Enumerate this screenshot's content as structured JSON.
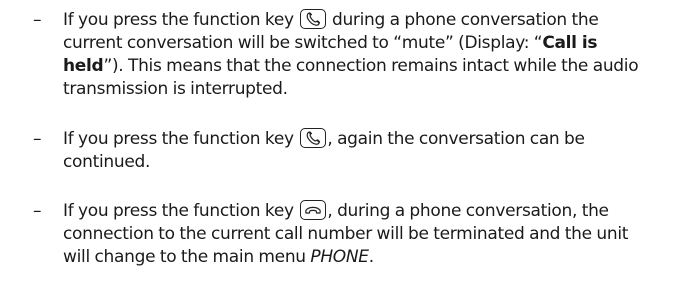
{
  "bullets": [
    {
      "dash": "–",
      "lines": {
        "l1_a": "If you press the function key",
        "l1_b": "during a phone conversation the",
        "l2_a": "current conversation will be switched to “mute” (Display: “",
        "l2_bold": "Call is",
        "l3_bold": "held",
        "l3_b": "”). This means that the connection remains intact while the audio",
        "l4": "transmission is interrupted."
      },
      "key_icon": "phone-pickup-icon"
    },
    {
      "dash": "–",
      "lines": {
        "l1_a": "If you press the function key",
        "l1_b": ", again the conversation can be",
        "l2": "continued."
      },
      "key_icon": "phone-pickup-icon"
    },
    {
      "dash": "–",
      "lines": {
        "l1_a": "If you press the function key",
        "l1_b": ", during a phone conversation, the",
        "l2": "connection to the current call number will be terminated and the unit",
        "l3_a": "will change to the main menu",
        "l3_italic": "PHONE",
        "l3_b": "."
      },
      "key_icon": "phone-hangup-icon"
    }
  ]
}
